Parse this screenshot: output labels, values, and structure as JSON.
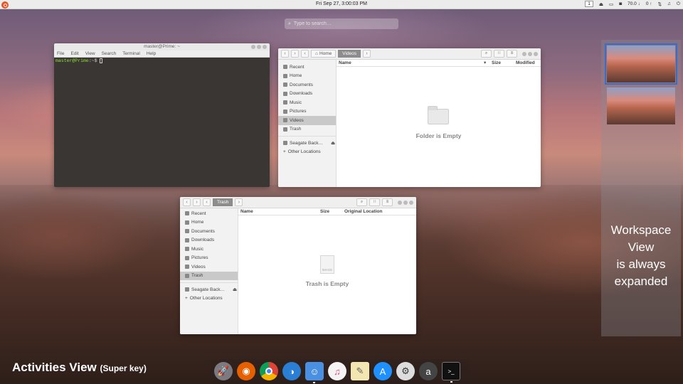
{
  "topbar": {
    "clock": "Fri Sep 27,  3:00:03 PM",
    "workspace_num": "1",
    "download_rate": "70.0 ↓",
    "upload_rate": "0 ↑"
  },
  "search": {
    "placeholder": "Type to search…"
  },
  "terminal": {
    "title": "master@Prime: ~",
    "menu": [
      "File",
      "Edit",
      "View",
      "Search",
      "Terminal",
      "Help"
    ],
    "prompt_user": "master@Prime",
    "prompt_path": ":~$"
  },
  "fm_videos": {
    "crumb_home": "Home",
    "crumb_current": "Videos",
    "columns": {
      "name": "Name",
      "size": "Size",
      "modified": "Modified"
    },
    "empty_text": "Folder is Empty"
  },
  "fm_trash": {
    "crumb_current": "Trash",
    "columns": {
      "name": "Name",
      "size": "Size",
      "original_location": "Original Location"
    },
    "empty_text": "Trash is Empty",
    "image_label": "IMAGE"
  },
  "sidebar": {
    "items": [
      "Recent",
      "Home",
      "Documents",
      "Downloads",
      "Music",
      "Pictures",
      "Videos",
      "Trash"
    ],
    "drive": "Seagate Back…",
    "other": "Other Locations"
  },
  "workspace": {
    "caption": "Workspace\nView\nis always\nexpanded"
  },
  "activities": {
    "title": "Activities View",
    "hint": "(Super key)"
  },
  "dock": {
    "apps": [
      "launchpad",
      "firefox",
      "chrome",
      "browser",
      "finder",
      "itunes",
      "notes",
      "app-store",
      "settings",
      "amazon",
      "terminal"
    ]
  },
  "colors": {
    "ubuntu_orange": "#e95420",
    "selection_blue": "#3b6dc6",
    "terminal_green": "#8ae234"
  }
}
